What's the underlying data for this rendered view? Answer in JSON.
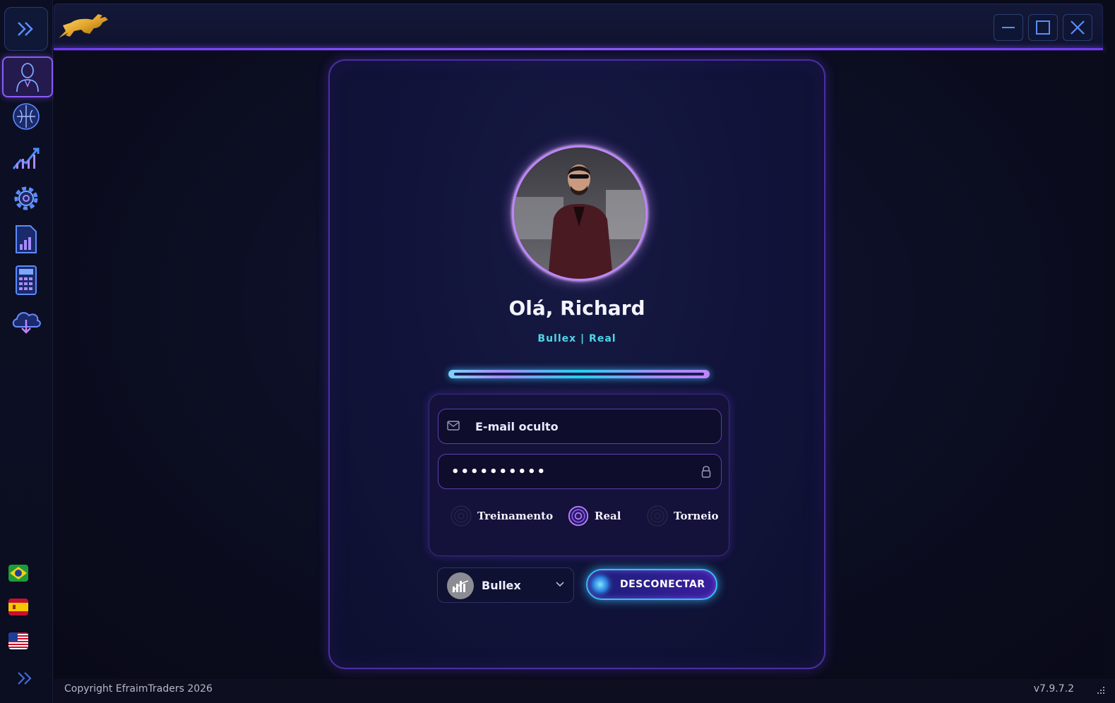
{
  "window": {
    "logo_icon": "bull-logo",
    "controls": [
      "minimize-icon",
      "maximize-icon",
      "close-icon"
    ]
  },
  "sidebar": {
    "expand_icon": "double-chevron-right-icon",
    "items": [
      {
        "icon": "user-profile-icon",
        "active": true
      },
      {
        "icon": "brain-icon",
        "active": false
      },
      {
        "icon": "trending-chart-icon",
        "active": false
      },
      {
        "icon": "gear-icon",
        "active": false
      },
      {
        "icon": "report-icon",
        "active": false
      },
      {
        "icon": "calculator-icon",
        "active": false
      },
      {
        "icon": "cloud-download-icon",
        "active": false
      }
    ],
    "languages": [
      "brazil-flag",
      "spain-flag",
      "usa-flag"
    ],
    "collapse_icon": "double-chevron-right-icon"
  },
  "profile": {
    "greeting": "Olá, Richard",
    "account_info": "Bullex | Real",
    "progress": 1.0
  },
  "login": {
    "email_value": "E-mail oculto",
    "password_value": "••••••••••",
    "account_types": [
      {
        "label": "Treinamento",
        "selected": false
      },
      {
        "label": "Real",
        "selected": true
      },
      {
        "label": "Torneio",
        "selected": false
      }
    ]
  },
  "broker": {
    "selected": "Bullex"
  },
  "actions": {
    "disconnect_label": "DESCONECTAR"
  },
  "footer": {
    "copyright": "Copyright EfraimTraders 2026",
    "version": "v7.9.7.2"
  },
  "colors": {
    "accent": "#8b5cf6",
    "cyan": "#4fd6e8",
    "background": "#0a0b1a"
  }
}
